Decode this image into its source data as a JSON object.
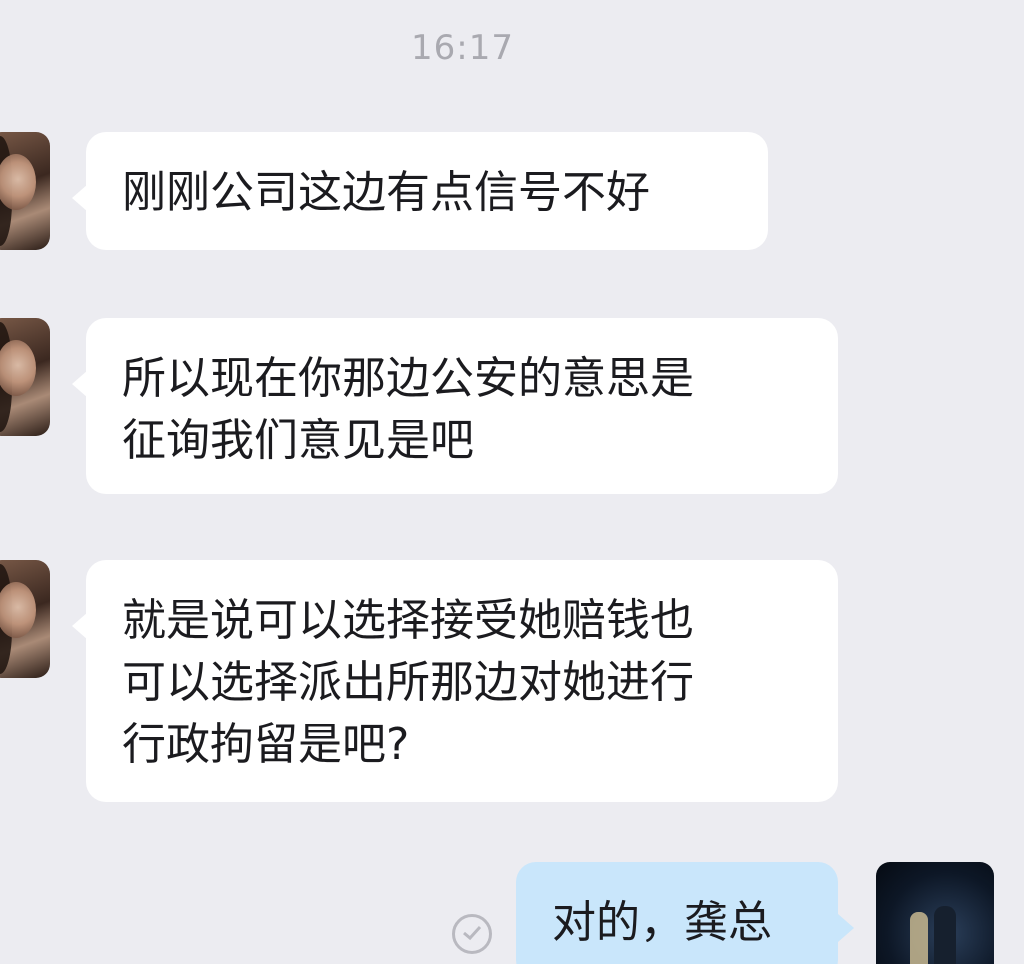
{
  "chat": {
    "timestamp": "16:17",
    "messages": [
      {
        "sender": "other",
        "lines": [
          "刚刚公司这边有点信号不好"
        ]
      },
      {
        "sender": "other",
        "lines": [
          "所以现在你那边公安的意思是",
          "征询我们意见是吧"
        ]
      },
      {
        "sender": "other",
        "lines": [
          "就是说可以选择接受她赔钱也",
          "可以选择派出所那边对她进行",
          "行政拘留是吧?"
        ]
      },
      {
        "sender": "self",
        "lines": [
          "对的，龚总"
        ]
      }
    ]
  },
  "colors": {
    "background": "#ececf1",
    "incoming_bubble": "#ffffff",
    "outgoing_bubble": "#c9e6fb",
    "timestamp_text": "#a9a9b0"
  },
  "icons": {
    "read_status": "check-circle-icon"
  }
}
